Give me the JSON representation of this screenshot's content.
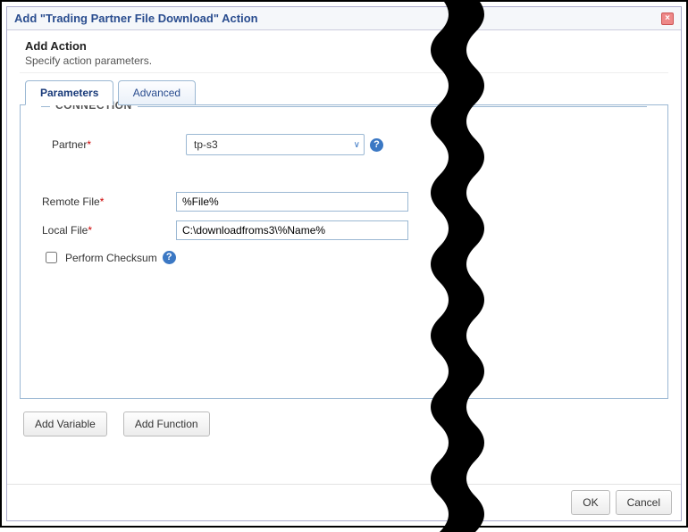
{
  "dialog": {
    "title": "Add \"Trading Partner File Download\" Action",
    "heading": "Add Action",
    "subheading": "Specify action parameters."
  },
  "tabs": {
    "parameters": "Parameters",
    "advanced": "Advanced"
  },
  "fieldset": {
    "connection": "CONNECTION"
  },
  "labels": {
    "partner": "Partner",
    "remote_file": "Remote File",
    "local_file": "Local File",
    "perform_checksum": "Perform Checksum"
  },
  "values": {
    "partner": "tp-s3",
    "remote_file": "%File%",
    "local_file": "C:\\downloadfroms3\\%Name%"
  },
  "buttons": {
    "add_variable": "Add Variable",
    "add_function": "Add Function",
    "ok": "OK",
    "cancel": "Cancel"
  },
  "required_marker": "*"
}
